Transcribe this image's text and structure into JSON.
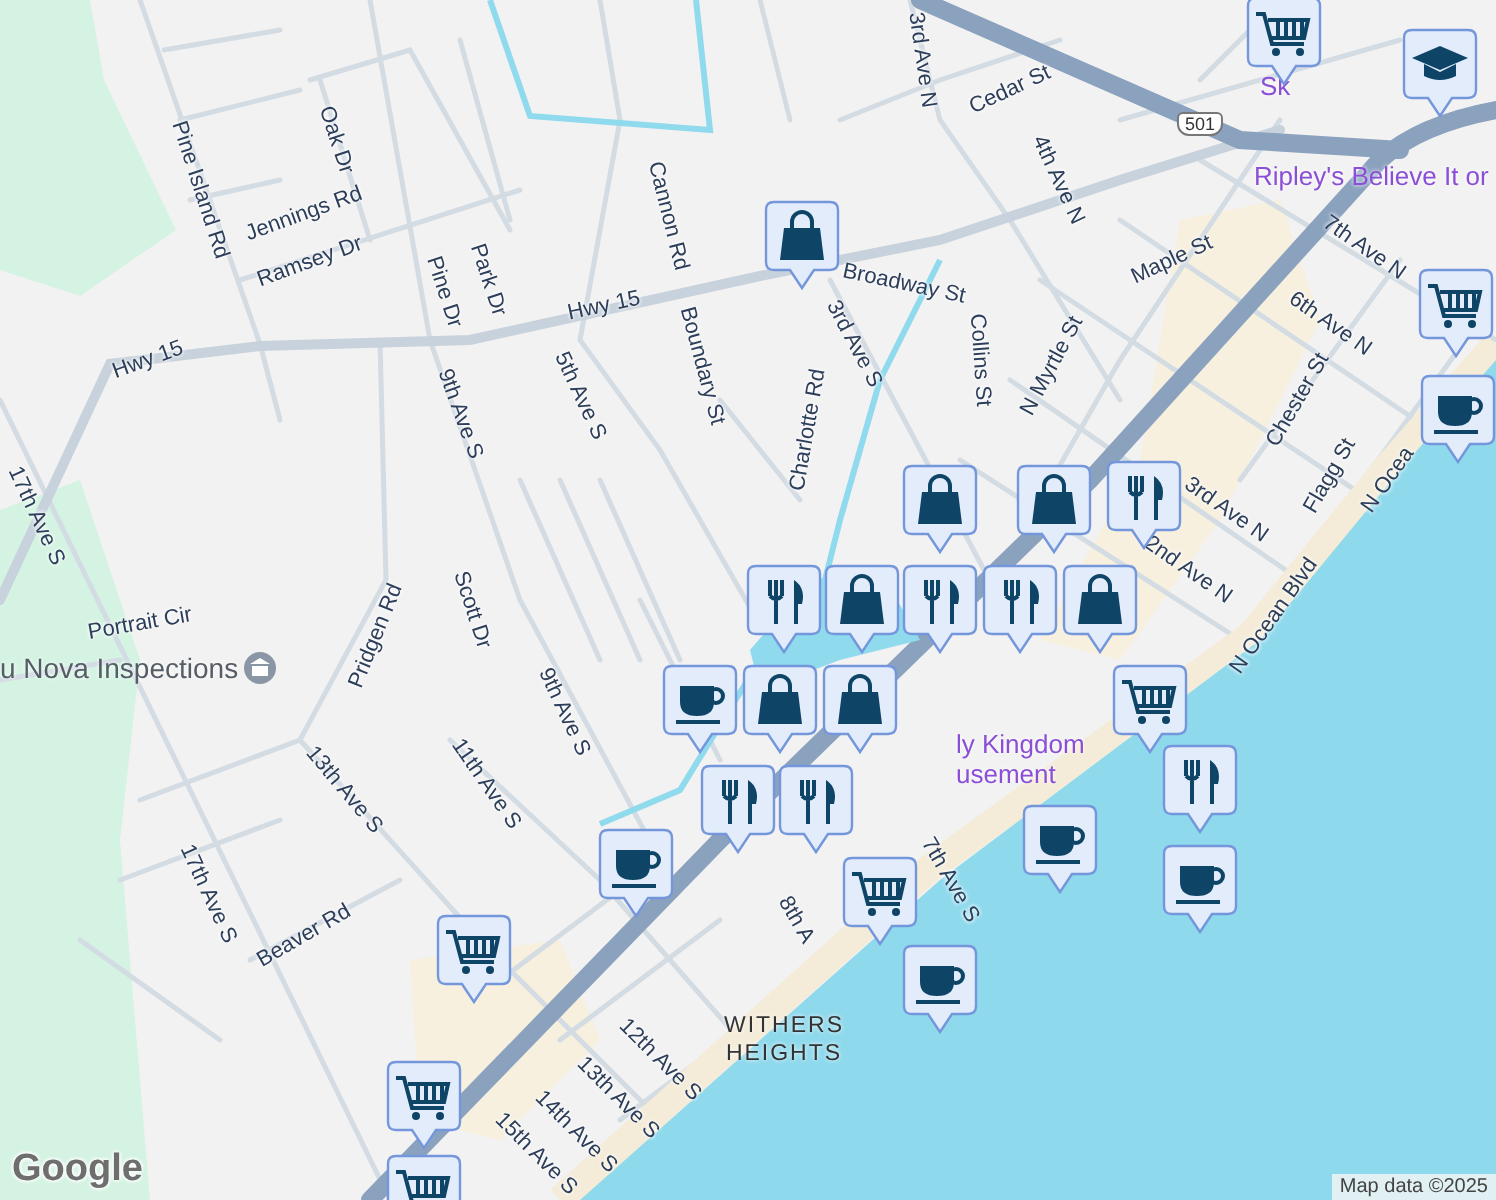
{
  "map": {
    "street_labels": [
      "Pine Island Rd",
      "Oak Dr",
      "Jennings Rd",
      "Ramsey Dr",
      "Pine Dr",
      "Park Dr",
      "Cannon Rd",
      "Hwy 15",
      "Hwy 15",
      "Boundary St",
      "5th Ave S",
      "9th Ave S",
      "17th Ave S",
      "Scott Dr",
      "Pridgen Rd",
      "Portrait Cir",
      "9th Ave S",
      "13th Ave S",
      "11th Ave S",
      "17th Ave S",
      "Beaver Rd",
      "12th Ave S",
      "13th Ave S",
      "14th Ave S",
      "15th Ave S",
      "3rd Ave N",
      "Cedar St",
      "4th Ave N",
      "Broadway St",
      "3rd Ave S",
      "Collins St",
      "N Myrtle St",
      "Maple St",
      "Charlotte Rd",
      "7th Ave N",
      "6th Ave N",
      "Chester St",
      "Flagg St",
      "N Ocea",
      "3rd Ave N",
      "2nd Ave N",
      "N Ocean Blvd",
      "7th Ave S",
      "8th A"
    ],
    "neighborhood": "WITHERS HEIGHTS",
    "places": [
      {
        "text": "u Nova Inspections",
        "kind": "business"
      },
      {
        "text": "Sk",
        "kind": "attraction"
      },
      {
        "text": "Ripley's Believe It or",
        "kind": "attraction"
      },
      {
        "text": "ly Kingdom",
        "kind": "attraction"
      },
      {
        "text": "usement",
        "kind": "attraction"
      }
    ],
    "route_shields": [
      "501"
    ],
    "markers": [
      {
        "kind": "grocery"
      },
      {
        "kind": "school"
      },
      {
        "kind": "shopping"
      },
      {
        "kind": "grocery"
      },
      {
        "kind": "cafe"
      },
      {
        "kind": "shopping"
      },
      {
        "kind": "food"
      },
      {
        "kind": "food"
      },
      {
        "kind": "food"
      },
      {
        "kind": "shopping"
      },
      {
        "kind": "shopping"
      },
      {
        "kind": "grocery"
      },
      {
        "kind": "food"
      },
      {
        "kind": "food"
      },
      {
        "kind": "cafe"
      },
      {
        "kind": "grocery"
      },
      {
        "kind": "cafe"
      },
      {
        "kind": "cafe"
      },
      {
        "kind": "grocery"
      },
      {
        "kind": "grocery"
      },
      {
        "kind": "grocery"
      },
      {
        "kind": "cafe"
      },
      {
        "kind": "shopping"
      },
      {
        "kind": "shopping"
      },
      {
        "kind": "food"
      },
      {
        "kind": "shopping"
      },
      {
        "kind": "food"
      },
      {
        "kind": "cafe"
      }
    ],
    "logo": "Google",
    "attribution": "Map data ©2025"
  }
}
